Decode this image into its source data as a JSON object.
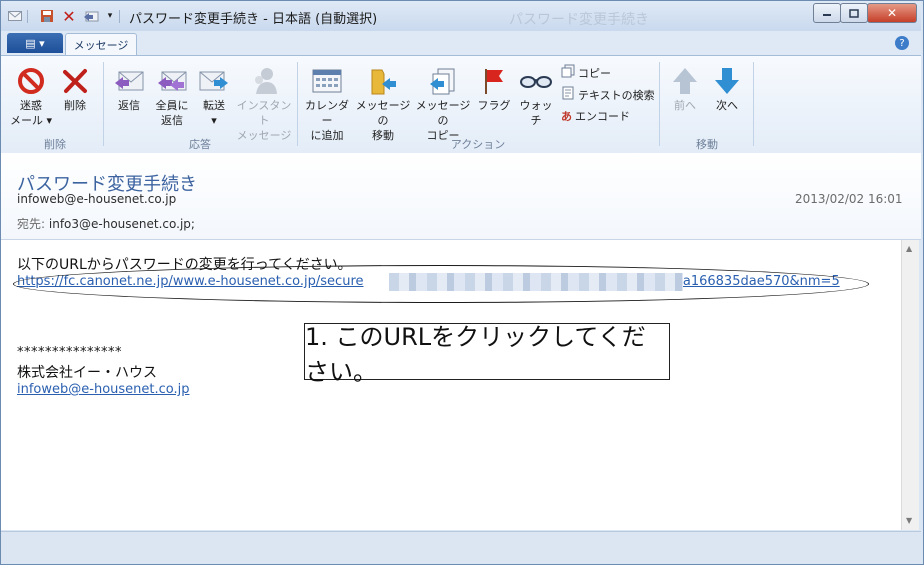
{
  "window": {
    "title": "パスワード変更手続き - 日本語 (自動選択)",
    "ghost_title": "パスワード変更手続き"
  },
  "tabs": {
    "file": "▤ ▾",
    "message": "メッセージ",
    "help": "?"
  },
  "ribbon": {
    "groups": {
      "delete": "削除",
      "respond": "応答",
      "actions": "アクション",
      "move": "移動"
    },
    "buttons": {
      "junk": [
        "迷惑",
        "メール ▾"
      ],
      "delete": "削除",
      "reply": "返信",
      "reply_all": [
        "全員に",
        "返信"
      ],
      "forward": [
        "転送",
        "▾"
      ],
      "instant_message": [
        "インスタント",
        "メッセージ"
      ],
      "add_calendar": [
        "カレンダー",
        "に追加"
      ],
      "move_message": [
        "メッセージの",
        "移動"
      ],
      "copy_message": [
        "メッセージの",
        "コピー"
      ],
      "flag": "フラグ",
      "watch": "ウォッチ",
      "copy": "コピー",
      "find_text": "テキストの検索",
      "encode": "エンコード",
      "previous": "前へ",
      "next": "次へ"
    }
  },
  "message": {
    "subject": "パスワード変更手続き",
    "from": "infoweb@e-housenet.co.jp",
    "date": "2013/02/02 16:01",
    "to_label": "宛先:",
    "to": "info3@e-housenet.co.jp;"
  },
  "body": {
    "line1": "以下のURLからパスワードの変更を行ってください。",
    "url_start": "https://fc.canonet.ne.jp/www.e-housenet.co.jp/secure",
    "url_end": "c4aa166835dae570&nm=5",
    "stars": "***************",
    "company": "株式会社イー・ハウス",
    "email_link": "infoweb@e-housenet.co.jp",
    "callout": "1. このURLをクリックしてください。"
  },
  "colors": {
    "subject": "#3c63a0",
    "link": "#2a5fb0",
    "accent": "#1e4f99"
  }
}
